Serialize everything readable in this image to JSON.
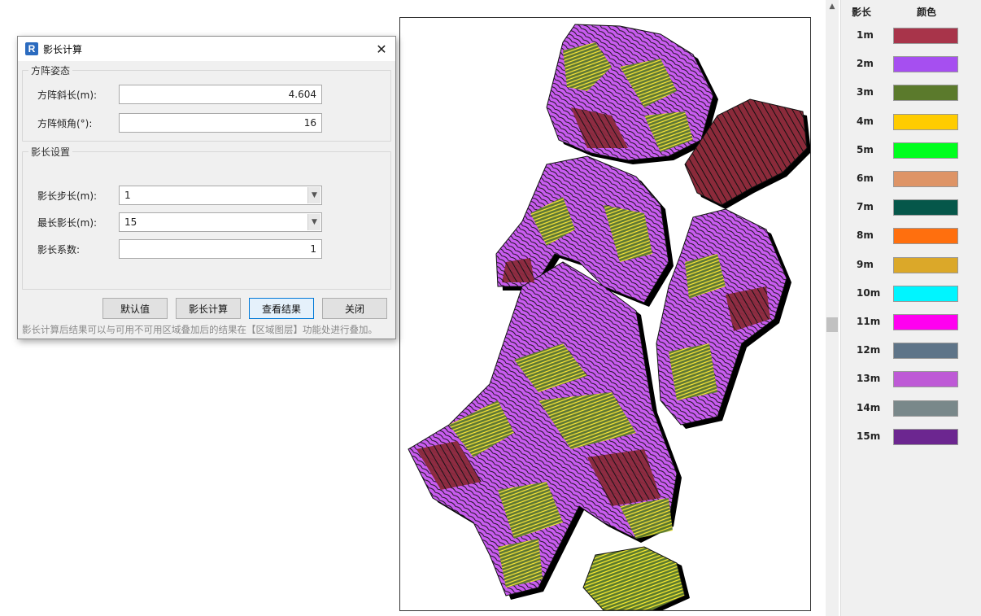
{
  "dialog": {
    "title": "影长计算",
    "app_icon_letter": "R",
    "close_glyph": "✕",
    "group1": {
      "legend": "方阵姿态",
      "slope_label": "方阵斜长(m):",
      "slope_value": "4.604",
      "tilt_label": "方阵倾角(°):",
      "tilt_value": "16"
    },
    "group2": {
      "legend": "影长设置",
      "step_label": "影长步长(m):",
      "step_value": "1",
      "max_label": "最长影长(m):",
      "max_value": "15",
      "coef_label": "影长系数:",
      "coef_value": "1"
    },
    "buttons": {
      "default": "默认值",
      "calc": "影长计算",
      "view": "查看结果",
      "close": "关闭"
    },
    "note": "影长计算后结果可以与可用不可用区域叠加后的结果在【区域图层】功能处进行叠加。"
  },
  "legend": {
    "header_length": "影长",
    "header_color": "颜色",
    "items": [
      {
        "label": "1m",
        "color": "#a8344a"
      },
      {
        "label": "2m",
        "color": "#a64ff0"
      },
      {
        "label": "3m",
        "color": "#5b7a2c"
      },
      {
        "label": "4m",
        "color": "#ffcc00"
      },
      {
        "label": "5m",
        "color": "#00ff1e"
      },
      {
        "label": "6m",
        "color": "#de9466"
      },
      {
        "label": "7m",
        "color": "#05574a"
      },
      {
        "label": "8m",
        "color": "#ff6f0e"
      },
      {
        "label": "9m",
        "color": "#dba829"
      },
      {
        "label": "10m",
        "color": "#00f5ff"
      },
      {
        "label": "11m",
        "color": "#ff00f0"
      },
      {
        "label": "12m",
        "color": "#5e7488"
      },
      {
        "label": "13m",
        "color": "#be5ad6"
      },
      {
        "label": "14m",
        "color": "#79888a"
      },
      {
        "label": "15m",
        "color": "#6c2690"
      }
    ]
  },
  "map": {
    "region_fill": "#c95cf0",
    "band_colors": [
      "#5b7a2c",
      "#ffee33",
      "#a8344a"
    ]
  }
}
